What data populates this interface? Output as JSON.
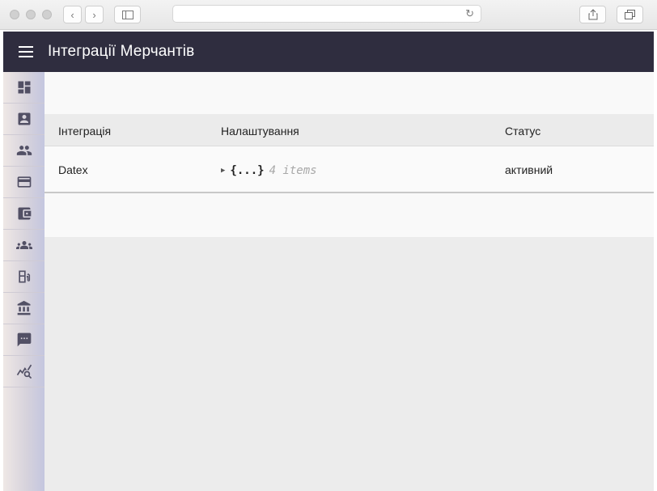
{
  "app": {
    "title": "Інтеграції Мерчантів"
  },
  "sidebar": {
    "items": [
      {
        "icon": "dashboard-icon"
      },
      {
        "icon": "account-box-icon"
      },
      {
        "icon": "people-icon"
      },
      {
        "icon": "credit-card-icon"
      },
      {
        "icon": "wallet-icon"
      },
      {
        "icon": "groups-icon"
      },
      {
        "icon": "fuel-station-icon"
      },
      {
        "icon": "bank-icon"
      },
      {
        "icon": "chat-icon"
      },
      {
        "icon": "query-stats-icon"
      }
    ]
  },
  "table": {
    "headers": {
      "integration": "Інтеграція",
      "settings": "Налаштування",
      "status": "Статус"
    },
    "rows": [
      {
        "integration": "Datex",
        "settings_braces": "{...}",
        "settings_count": "4 items",
        "status": "активний"
      }
    ]
  }
}
